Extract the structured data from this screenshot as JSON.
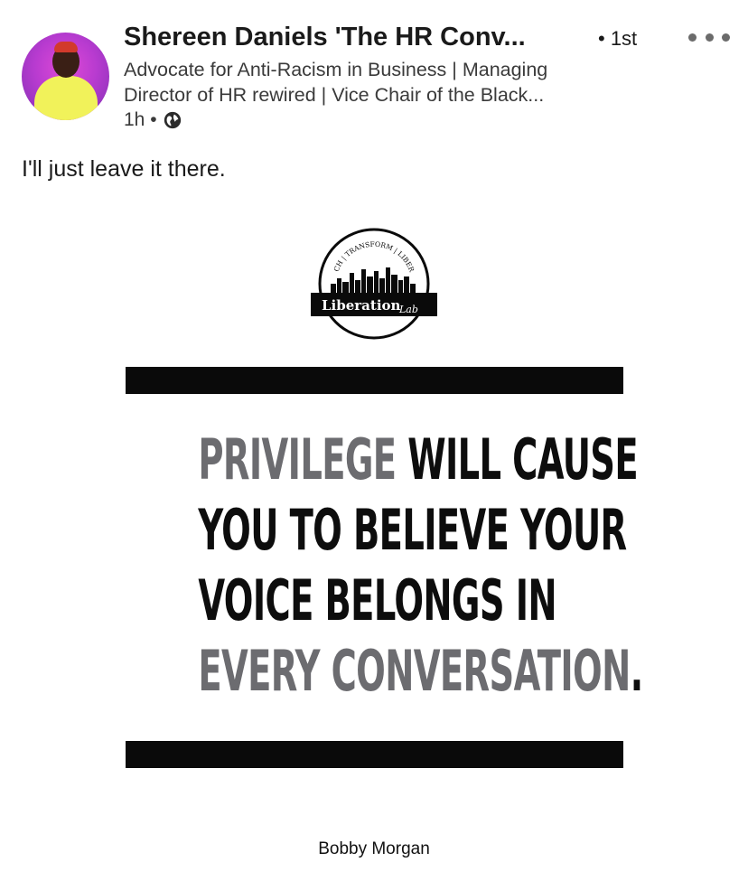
{
  "post": {
    "author": {
      "name": "Shereen Daniels 'The HR Conv...",
      "degree": "• 1st",
      "headline_line1": "Advocate for Anti-Racism in Business | Managing",
      "headline_line2": "Director of HR rewired | Vice Chair of the Black...",
      "time": "1h •"
    },
    "text": "I'll just leave it there."
  },
  "graphic": {
    "logo": {
      "arc_text": "TEACH | TRANSFORM | LIBERATE",
      "label_main": "Liberation",
      "label_script": "Lab"
    },
    "quote": {
      "l1_grey": "PRIVILEGE",
      "l1_black": " WILL CAUSE",
      "l2": "YOU TO BELIEVE YOUR",
      "l3": "VOICE BELONGS IN",
      "l4_grey": "EVERY CONVERSATION",
      "l4_black": "."
    },
    "credit": "Bobby Morgan"
  },
  "colors": {
    "quote_black": "#0d0d0d",
    "quote_grey": "#6c6c70",
    "avatar_bg": "#b83bd0",
    "hoodie": "#f1f25a"
  },
  "icons": {
    "more": "more-horizontal-icon",
    "visibility": "globe-icon"
  }
}
